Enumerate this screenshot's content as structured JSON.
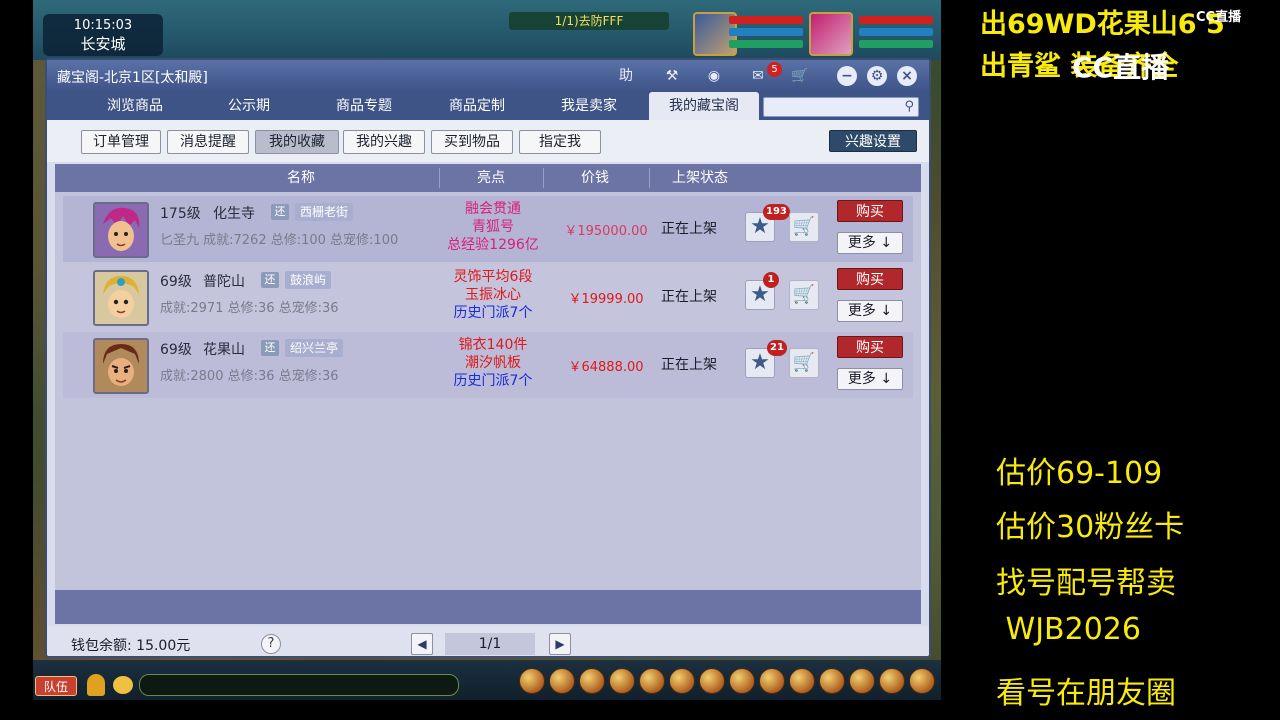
{
  "game": {
    "clock": "10:15:03",
    "city": "长安城",
    "task": "1/1)去防FFF",
    "team_label": "队伍"
  },
  "window": {
    "title": "藏宝阁-北京1区[太和殿]",
    "help_icon_label": "助",
    "message_badge": "5"
  },
  "nav": {
    "tabs": [
      "浏览商品",
      "公示期",
      "商品专题",
      "商品定制",
      "我是卖家",
      "我的藏宝阁"
    ]
  },
  "subnav": {
    "tabs": [
      "订单管理",
      "消息提醒",
      "我的收藏",
      "我的兴趣",
      "买到物品",
      "指定我"
    ],
    "interest_button": "兴趣设置"
  },
  "table": {
    "headers": [
      "名称",
      "亮点",
      "价钱",
      "上架状态"
    ],
    "rows": [
      {
        "level": "175级",
        "school": "化生寺",
        "tag": "还",
        "server": "西栅老街",
        "stats": "匕圣九  成就:7262  总修:100  总宠修:100",
        "highlights": [
          "融会贯通",
          "青狐号",
          "总经验1296亿"
        ],
        "highlight_colors": [
          "#d8207a",
          "#d8207a",
          "#d8207a"
        ],
        "price": "￥195000.00",
        "status": "正在上架",
        "favorites": "193",
        "buy": "购买",
        "more": "更多 ↓"
      },
      {
        "level": "69级",
        "school": "普陀山",
        "tag": "还",
        "server": "鼓浪屿",
        "stats": "成就:2971  总修:36  总宠修:36",
        "highlights": [
          "灵饰平均6段",
          "玉振冰心",
          "历史门派7个"
        ],
        "highlight_colors": [
          "#e01818",
          "#e01818",
          "#1a2cd8"
        ],
        "price": "￥19999.00",
        "status": "正在上架",
        "favorites": "1",
        "buy": "购买",
        "more": "更多 ↓"
      },
      {
        "level": "69级",
        "school": "花果山",
        "tag": "还",
        "server": "绍兴兰亭",
        "stats": "成就:2800  总修:36  总宠修:36",
        "highlights": [
          "锦衣140件",
          "潮汐帆板",
          "历史门派7个"
        ],
        "highlight_colors": [
          "#e01818",
          "#e01818",
          "#1a2cd8"
        ],
        "price": "￥64888.00",
        "status": "正在上架",
        "favorites": "21",
        "buy": "购买",
        "more": "更多 ↓"
      }
    ]
  },
  "footer": {
    "wallet": "钱包余额: 15.00元",
    "help": "?",
    "page": "1/1"
  },
  "overlay": {
    "top_line1": "出69WD花果山6 5",
    "top_line2": "出青鲨 装备齐全",
    "cc_logo": "CC直播",
    "cc_small": "CC直播",
    "side_lines": [
      "估价69-109",
      "估价30粉丝卡",
      "找号配号帮卖",
      " WJB2026",
      "看号在朋友圈"
    ]
  },
  "colors": {
    "price_red": "#e01818",
    "overlay_yellow": "#f7ea0c",
    "window_title_blue": "#3e5386"
  }
}
